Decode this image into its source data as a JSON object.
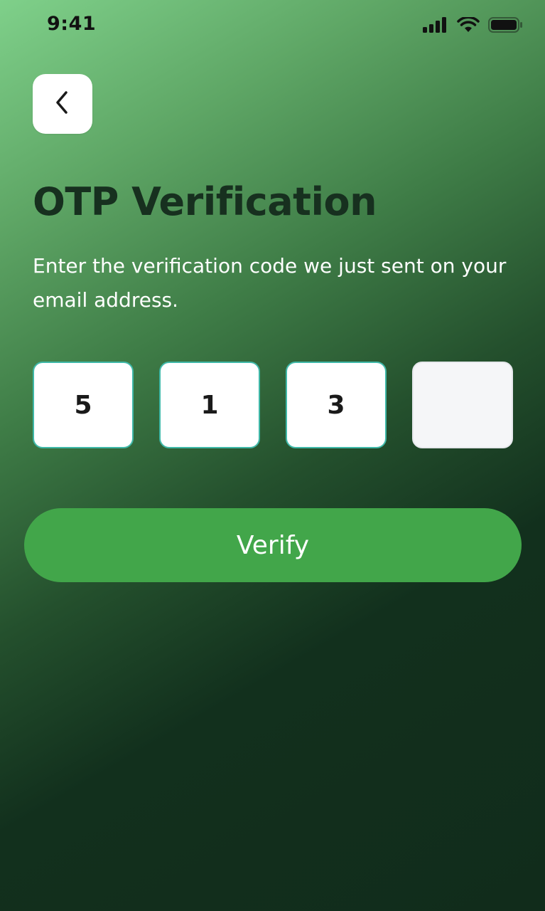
{
  "status_bar": {
    "time": "9:41",
    "icons": [
      "signal-icon",
      "wifi-icon",
      "battery-icon"
    ]
  },
  "header": {
    "back_icon": "chevron-left-icon"
  },
  "title": "OTP Verification",
  "subtitle": "Enter the verification code we just sent on your email address.",
  "otp": {
    "digits": [
      "5",
      "1",
      "3",
      ""
    ]
  },
  "verify_button": {
    "label": "Verify"
  },
  "colors": {
    "accent": "#42a64a",
    "otp_border": "#3fb8a8",
    "title": "#17301f",
    "background_dark": "#112c1b",
    "background_light": "#7fd08a"
  }
}
